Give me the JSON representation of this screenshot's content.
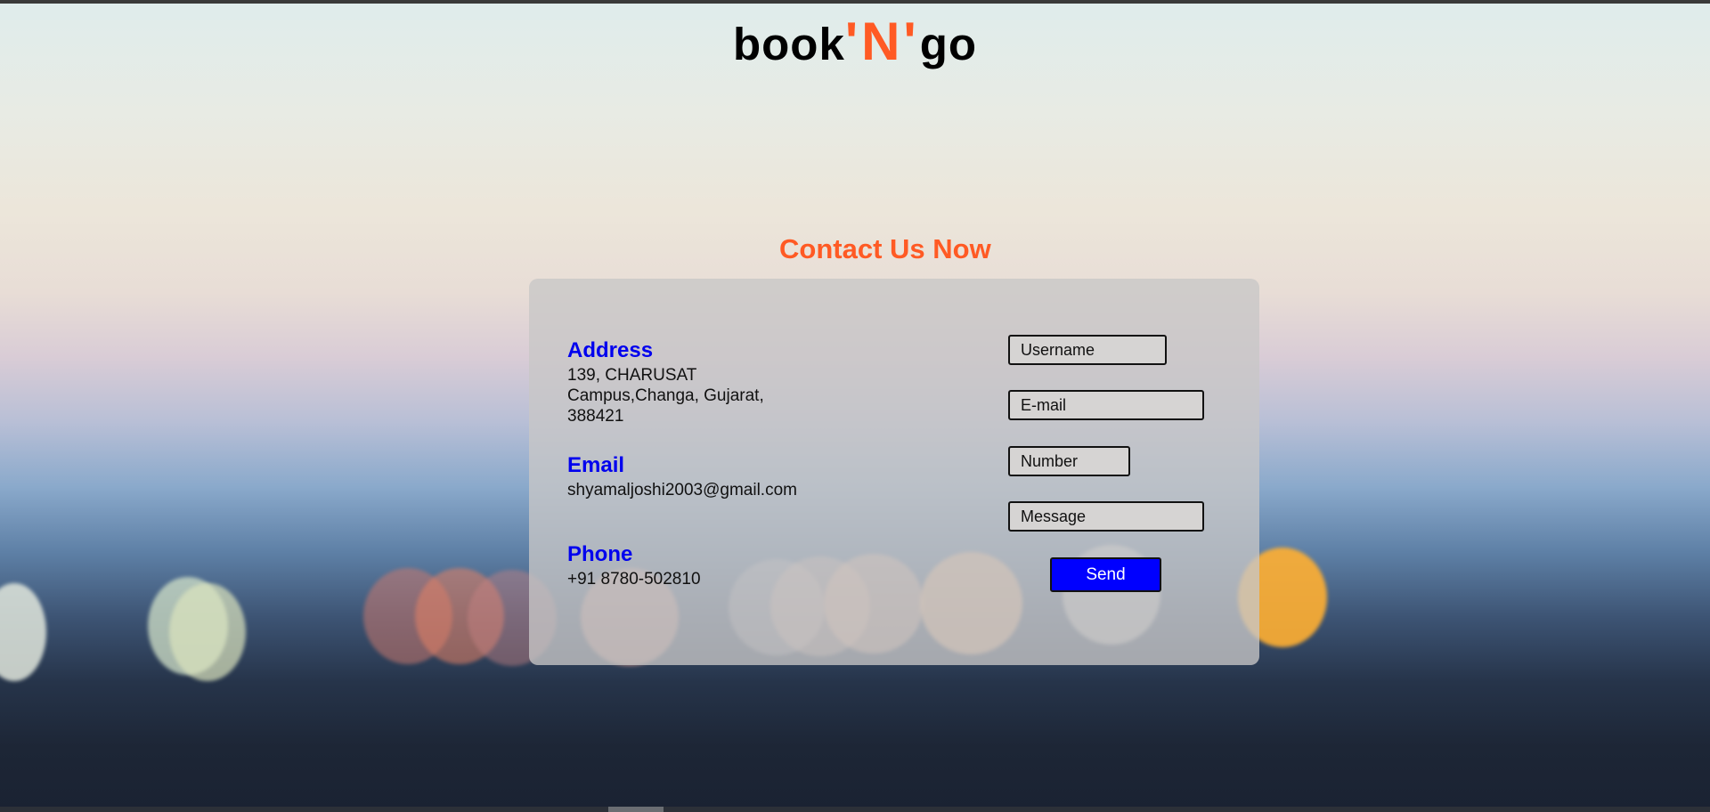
{
  "logo": {
    "part1": "book",
    "accent": "'N'",
    "part2": "go",
    "accent_color": "#ff5a24"
  },
  "contact": {
    "title": "Contact Us Now",
    "address_heading": "Address",
    "address_lines": "139, CHARUSAT\nCampus,Changa, Gujarat,\n388421",
    "email_heading": "Email",
    "email_value": "shyamaljoshi2003@gmail.com",
    "phone_heading": "Phone",
    "phone_value": "+91 8780-502810"
  },
  "form": {
    "username_placeholder": "Username",
    "email_placeholder": "E-mail",
    "number_placeholder": "Number",
    "message_placeholder": "Message",
    "send_label": "Send",
    "send_color": "#0000ff"
  }
}
